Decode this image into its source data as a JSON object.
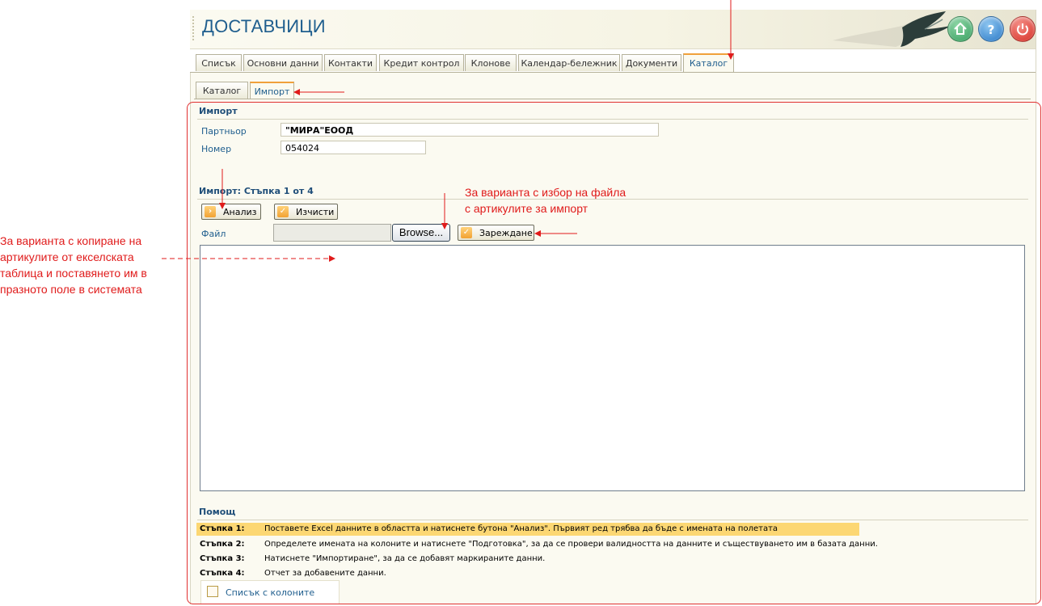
{
  "header": {
    "title": "ДОСТАВЧИЦИ",
    "buttons": [
      "home-icon",
      "help-icon",
      "power-icon"
    ]
  },
  "tabs": [
    {
      "label": "Списък"
    },
    {
      "label": "Основни данни"
    },
    {
      "label": "Контакти"
    },
    {
      "label": "Кредит контрол"
    },
    {
      "label": "Клонове"
    },
    {
      "label": "Календар-бележник"
    },
    {
      "label": "Документи"
    },
    {
      "label": "Каталог",
      "active": true
    }
  ],
  "subtabs": [
    {
      "label": "Каталог"
    },
    {
      "label": "Импорт",
      "active": true
    }
  ],
  "import_section": {
    "title": "Импорт",
    "partner_label": "Партньор",
    "partner_value": "\"МИРА\"ЕООД",
    "number_label": "Номер",
    "number_value": "054024"
  },
  "step": {
    "title": "Импорт: Стъпка 1 от 4",
    "analyze_button": "Анализ",
    "clear_button": "Изчисти",
    "file_label": "Файл",
    "browse_button": "Browse...",
    "load_button": "Зареждане"
  },
  "help": {
    "title": "Помощ",
    "steps": [
      {
        "key": "Стъпка 1:",
        "text": "Поставете Excel данните в областта и натиснете бутона \"Анализ\". Първият ред трябва да бъде с имената на полетата",
        "highlighted": true
      },
      {
        "key": "Стъпка 2:",
        "text": "Определете имената на колоните и натиснете \"Подготовка\", за да се провери валидността на данните и съществуването им в базата данни."
      },
      {
        "key": "Стъпка 3:",
        "text": "Натиснете \"Импортиране\", за да се добавят маркираните данни."
      },
      {
        "key": "Стъпка 4:",
        "text": "Отчет за добавените данни."
      }
    ],
    "column_list_label": "Списък с колоните"
  },
  "annotations": {
    "file_choice_line1": "За варианта с избор на файла",
    "file_choice_line2": "с артикулите за импорт",
    "copy_line1": "За варианта с копиране на",
    "copy_line2": "артикулите от екселската",
    "copy_line3": "таблица и поставянето им  в",
    "copy_line4": "празното поле в системата",
    "color": "#e01b1b"
  }
}
